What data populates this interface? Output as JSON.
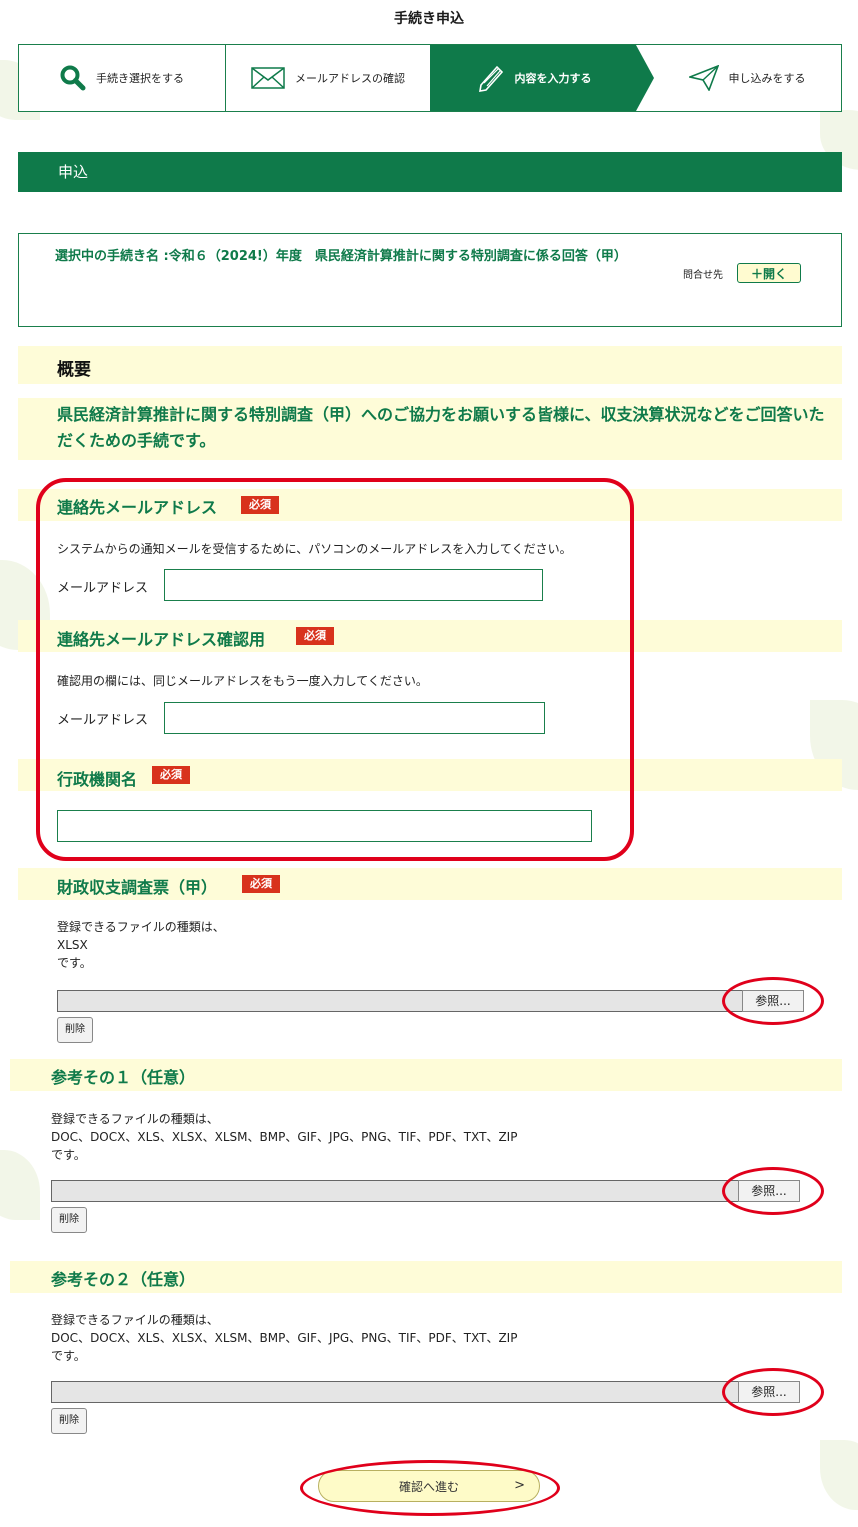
{
  "header": {
    "title": "手続き申込"
  },
  "steps": [
    {
      "label": "手続き選択をする",
      "icon": "search-icon"
    },
    {
      "label": "メールアドレスの確認",
      "icon": "mail-icon"
    },
    {
      "label": "内容を入力する",
      "icon": "pencil-icon",
      "active": true
    },
    {
      "label": "申し込みをする",
      "icon": "send-icon"
    }
  ],
  "section": {
    "title": "申込"
  },
  "procedure": {
    "name": "選択中の手続き名 :令和６（2024!）年度　県民経済計算推計に関する特別調査に係る回答（甲）",
    "contact_label": "問合せ先",
    "open_button": "＋開く"
  },
  "overview": {
    "title": "概要",
    "description": "県民経済計算推計に関する特別調査（甲）へのご協力をお願いする皆様に、収支決算状況などをご回答いただくための手続です。"
  },
  "required_badge": "必須",
  "fields": {
    "email": {
      "title": "連絡先メールアドレス",
      "help": "システムからの通知メールを受信するために、パソコンのメールアドレスを入力してください。",
      "label": "メールアドレス",
      "value": ""
    },
    "email_confirm": {
      "title": "連絡先メールアドレス確認用",
      "help": "確認用の欄には、同じメールアドレスをもう一度入力してください。",
      "label": "メールアドレス",
      "value": ""
    },
    "agency": {
      "title": "行政機関名",
      "value": ""
    }
  },
  "files": [
    {
      "title": "財政収支調査票（甲）",
      "required": true,
      "types_prefix": "登録できるファイルの種類は、",
      "types": "XLSX",
      "types_suffix": "です。",
      "browse": "参照...",
      "delete": "削除"
    },
    {
      "title": "参考その１（任意）",
      "required": false,
      "types_prefix": "登録できるファイルの種類は、",
      "types": "DOC、DOCX、XLS、XLSX、XLSM、BMP、GIF、JPG、PNG、TIF、PDF、TXT、ZIP",
      "types_suffix": "です。",
      "browse": "参照...",
      "delete": "削除"
    },
    {
      "title": "参考その２（任意）",
      "required": false,
      "types_prefix": "登録できるファイルの種類は、",
      "types": "DOC、DOCX、XLS、XLSX、XLSM、BMP、GIF、JPG、PNG、TIF、PDF、TXT、ZIP",
      "types_suffix": "です。",
      "browse": "参照...",
      "delete": "削除"
    }
  ],
  "confirm_button": {
    "label": "確認へ進む",
    "chevron": ">"
  },
  "colors": {
    "brand_green": "#0f7a4a",
    "band_yellow": "#fefcd8",
    "required_red": "#d8321c",
    "annotation_red": "#e0001b"
  }
}
